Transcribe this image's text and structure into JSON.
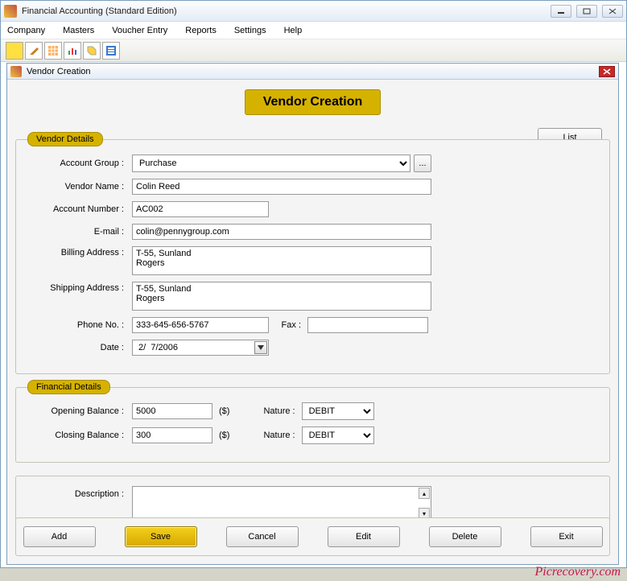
{
  "app": {
    "title": "Financial Accounting (Standard Edition)"
  },
  "menu": {
    "company": "Company",
    "masters": "Masters",
    "voucher": "Voucher Entry",
    "reports": "Reports",
    "settings": "Settings",
    "help": "Help"
  },
  "inner": {
    "title": "Vendor Creation",
    "banner": "Vendor Creation"
  },
  "buttons": {
    "list": "List",
    "add": "Add",
    "save": "Save",
    "cancel": "Cancel",
    "edit": "Edit",
    "delete": "Delete",
    "exit": "Exit",
    "ellipsis": "..."
  },
  "vendor_group": {
    "legend": "Vendor Details",
    "account_group_label": "Account Group  :",
    "account_group_value": "Purchase",
    "vendor_name_label": "Vendor Name  :",
    "vendor_name_value": "Colin Reed",
    "account_number_label": "Account Number  :",
    "account_number_value": "AC002",
    "email_label": "E-mail  :",
    "email_value": "colin@pennygroup.com",
    "billing_label": "Billing Address  :",
    "billing_value": "T-55, Sunland\nRogers",
    "shipping_label": "Shipping Address  :",
    "shipping_value": "T-55, Sunland\nRogers",
    "phone_label": "Phone No.  :",
    "phone_value": "333-645-656-5767",
    "fax_label": "Fax  :",
    "fax_value": "",
    "date_label": "Date  :",
    "date_value": " 2/  7/2006"
  },
  "fin_group": {
    "legend": "Financial Details",
    "opening_label": "Opening Balance  :",
    "opening_value": "5000",
    "closing_label": "Closing Balance  :",
    "closing_value": "300",
    "currency": "($)",
    "nature_label": "Nature :",
    "nature_value": "DEBIT"
  },
  "desc": {
    "label": "Description  :",
    "value": ""
  },
  "watermark": "Picrecovery.com"
}
